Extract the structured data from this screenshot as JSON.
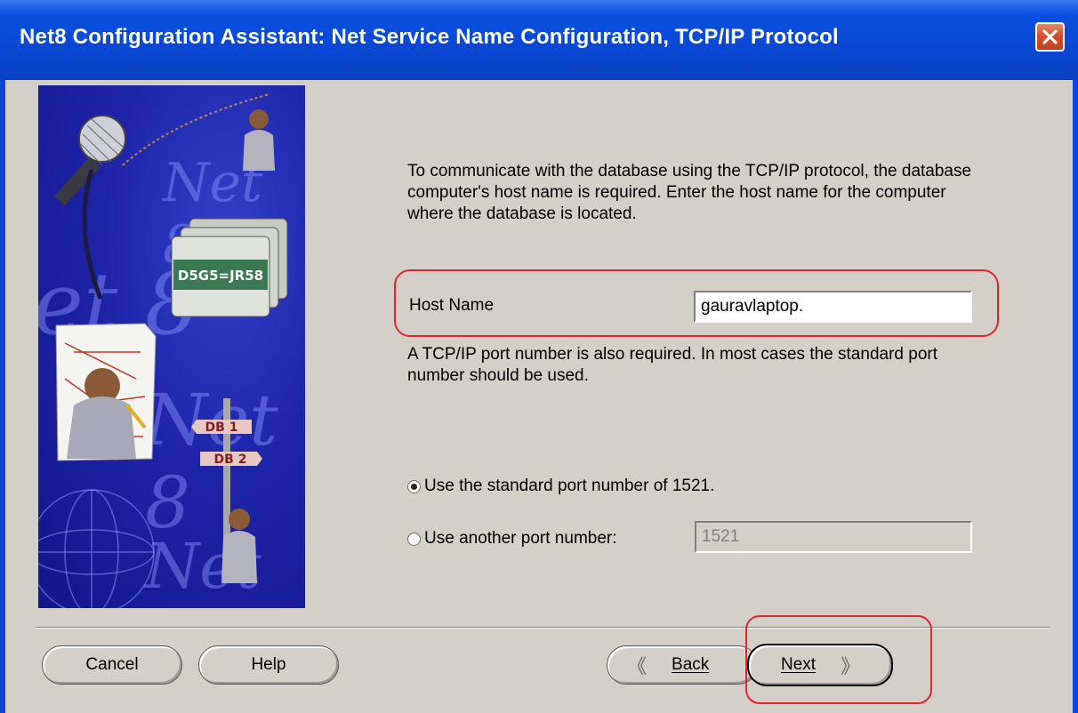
{
  "window": {
    "title": "Net8 Configuration Assistant: Net Service Name Configuration,  TCP/IP Protocol",
    "close_icon": "close-icon"
  },
  "art": {
    "watermark_text": [
      "Net 8",
      "et 8",
      "Net 8",
      "Net 8"
    ],
    "signpost_labels": [
      "DB 1",
      "DB 2"
    ],
    "folder_label": "D5G5=JR58"
  },
  "content": {
    "intro_text": "To communicate with the database using the TCP/IP protocol, the database computer's host name is required. Enter the host name for the computer where the database is located.",
    "host": {
      "label": "Host Name",
      "value": "gauravlaptop."
    },
    "port_text": "A TCP/IP port number is also required. In most cases the standard port number should be used.",
    "radio_standard": {
      "label": "Use the standard port number of 1521.",
      "checked": true
    },
    "radio_other": {
      "label": "Use another port number:",
      "checked": false,
      "value": "1521"
    }
  },
  "buttons": {
    "cancel": "Cancel",
    "help": "Help",
    "back": "Back",
    "next": "Next",
    "back_icon": "chevron-left-icon",
    "next_icon": "chevron-right-icon"
  },
  "colors": {
    "titlebar": "#0a48d4",
    "dialog_bg": "#d4d0c8",
    "highlight": "#e0262c"
  }
}
